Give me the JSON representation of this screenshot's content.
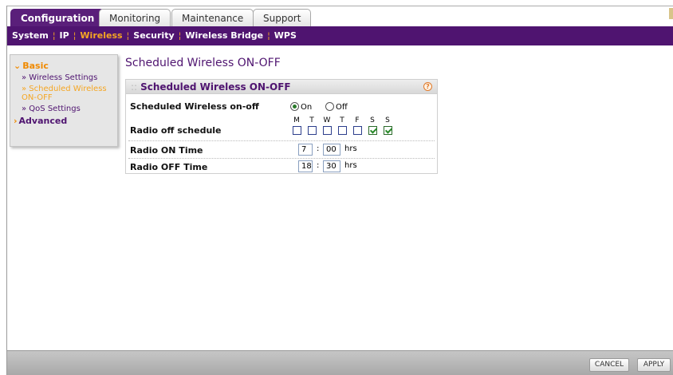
{
  "tabs": [
    {
      "label": "Configuration",
      "active": true
    },
    {
      "label": "Monitoring",
      "active": false
    },
    {
      "label": "Maintenance",
      "active": false
    },
    {
      "label": "Support",
      "active": false
    }
  ],
  "subnav": [
    {
      "label": "System",
      "active": false
    },
    {
      "label": "IP",
      "active": false
    },
    {
      "label": "Wireless",
      "active": true
    },
    {
      "label": "Security",
      "active": false
    },
    {
      "label": "Wireless Bridge",
      "active": false
    },
    {
      "label": "WPS",
      "active": false
    }
  ],
  "sidebar": {
    "basic_label": "Basic",
    "items": [
      {
        "label": "» Wireless Settings",
        "current": false
      },
      {
        "label": "» Scheduled Wireless ON-OFF",
        "current": true
      },
      {
        "label": "» QoS Settings",
        "current": false
      }
    ],
    "advanced_label": "Advanced"
  },
  "page": {
    "title": "Scheduled Wireless ON-OFF"
  },
  "panel": {
    "title": "Scheduled Wireless ON-OFF",
    "help_glyph": "?",
    "onoff": {
      "label": "Scheduled Wireless on-off",
      "on_label": "On",
      "off_label": "Off",
      "selected": "On"
    },
    "schedule": {
      "label": "Radio off schedule",
      "days": [
        {
          "letter": "M",
          "checked": false
        },
        {
          "letter": "T",
          "checked": false
        },
        {
          "letter": "W",
          "checked": false
        },
        {
          "letter": "T",
          "checked": false
        },
        {
          "letter": "F",
          "checked": false
        },
        {
          "letter": "S",
          "checked": true
        },
        {
          "letter": "S",
          "checked": true
        }
      ]
    },
    "on_time": {
      "label": "Radio ON Time",
      "hour": "7",
      "minute": "00",
      "unit": "hrs"
    },
    "off_time": {
      "label": "Radio OFF Time",
      "hour": "18",
      "minute": "30",
      "unit": "hrs"
    }
  },
  "buttons": {
    "cancel": "CANCEL",
    "apply": "APPLY"
  },
  "colors": {
    "brand": "#4f1470",
    "accent": "#f5a623"
  }
}
